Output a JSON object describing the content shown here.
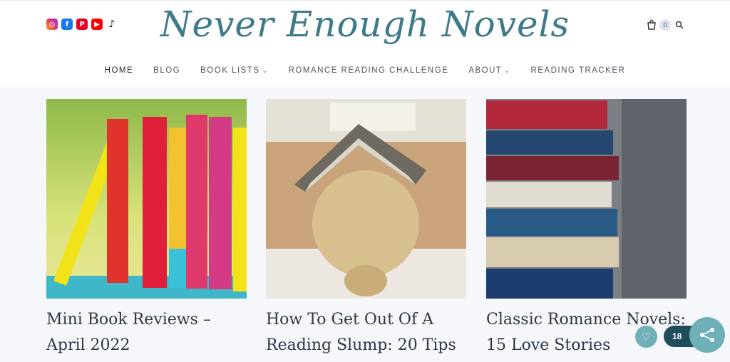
{
  "site": {
    "logo_text": "Never Enough Novels",
    "social_icons": [
      "instagram-icon",
      "facebook-icon",
      "pinterest-icon",
      "youtube-icon",
      "tiktok-icon"
    ],
    "accent_color": "#3d7a8a"
  },
  "header": {
    "cart_count": "0"
  },
  "nav": {
    "items": [
      {
        "label": "HOME",
        "has_dropdown": false,
        "active": true
      },
      {
        "label": "BLOG",
        "has_dropdown": false
      },
      {
        "label": "BOOK LISTS",
        "has_dropdown": true
      },
      {
        "label": "ROMANCE READING CHALLENGE",
        "has_dropdown": false
      },
      {
        "label": "ABOUT",
        "has_dropdown": true
      },
      {
        "label": "READING TRACKER",
        "has_dropdown": false
      }
    ]
  },
  "posts": [
    {
      "title": "Mini Book Reviews – April 2022"
    },
    {
      "title": "How To Get Out Of A Reading Slump: 20 Tips"
    },
    {
      "title": "Classic Romance Novels: 15 Love Stories"
    }
  ],
  "floating": {
    "share_count": "18"
  }
}
